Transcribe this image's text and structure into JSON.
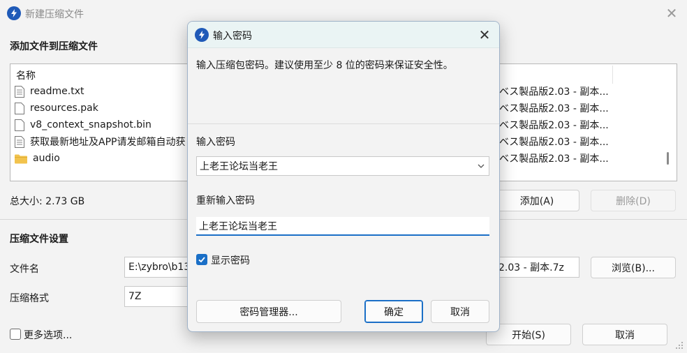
{
  "background": {
    "window_title": "新建压缩文件",
    "section_add": "添加文件到压缩文件",
    "list_header": "名称",
    "files": [
      {
        "name": "readme.txt",
        "icon": "text-file-icon",
        "right": "ベス製品版2.03 - 副本..."
      },
      {
        "name": "resources.pak",
        "icon": "file-icon",
        "right": "ベス製品版2.03 - 副本..."
      },
      {
        "name": "v8_context_snapshot.bin",
        "icon": "file-icon",
        "right": "ベス製品版2.03 - 副本..."
      },
      {
        "name": "获取最新地址及APP请发邮箱自动获",
        "icon": "text-file-icon",
        "right": "ベス製品版2.03 - 副本..."
      },
      {
        "name": "audio",
        "icon": "folder-icon",
        "right": "ベス製品版2.03 - 副本..."
      }
    ],
    "total_size": "总大小: 2.73 GB",
    "add_button": "添加(A)",
    "delete_button": "删除(D)",
    "section_settings": "压缩文件设置",
    "filename_label": "文件名",
    "filename_value_left": "E:\\zybro\\b13",
    "filename_value_right": "2.03 - 副本.7z",
    "browse_button": "浏览(B)...",
    "format_label": "压缩格式",
    "format_value": "7Z",
    "more_options": "更多选项...",
    "start_button": "开始(S)",
    "cancel_button": "取消"
  },
  "dialog": {
    "title": "输入密码",
    "description": "输入压缩包密码。建议使用至少 8 位的密码来保证安全性。",
    "password_label": "输入密码",
    "password_value": "上老王论坛当老王",
    "reenter_label": "重新输入密码",
    "reenter_value": "上老王论坛当老王",
    "show_password_label": "显示密码",
    "show_password_checked": true,
    "manager_button": "密码管理器...",
    "ok_button": "确定",
    "cancel_button": "取消"
  },
  "colors": {
    "accent": "#1a6fc7",
    "app_icon": "#1f5ab8"
  }
}
